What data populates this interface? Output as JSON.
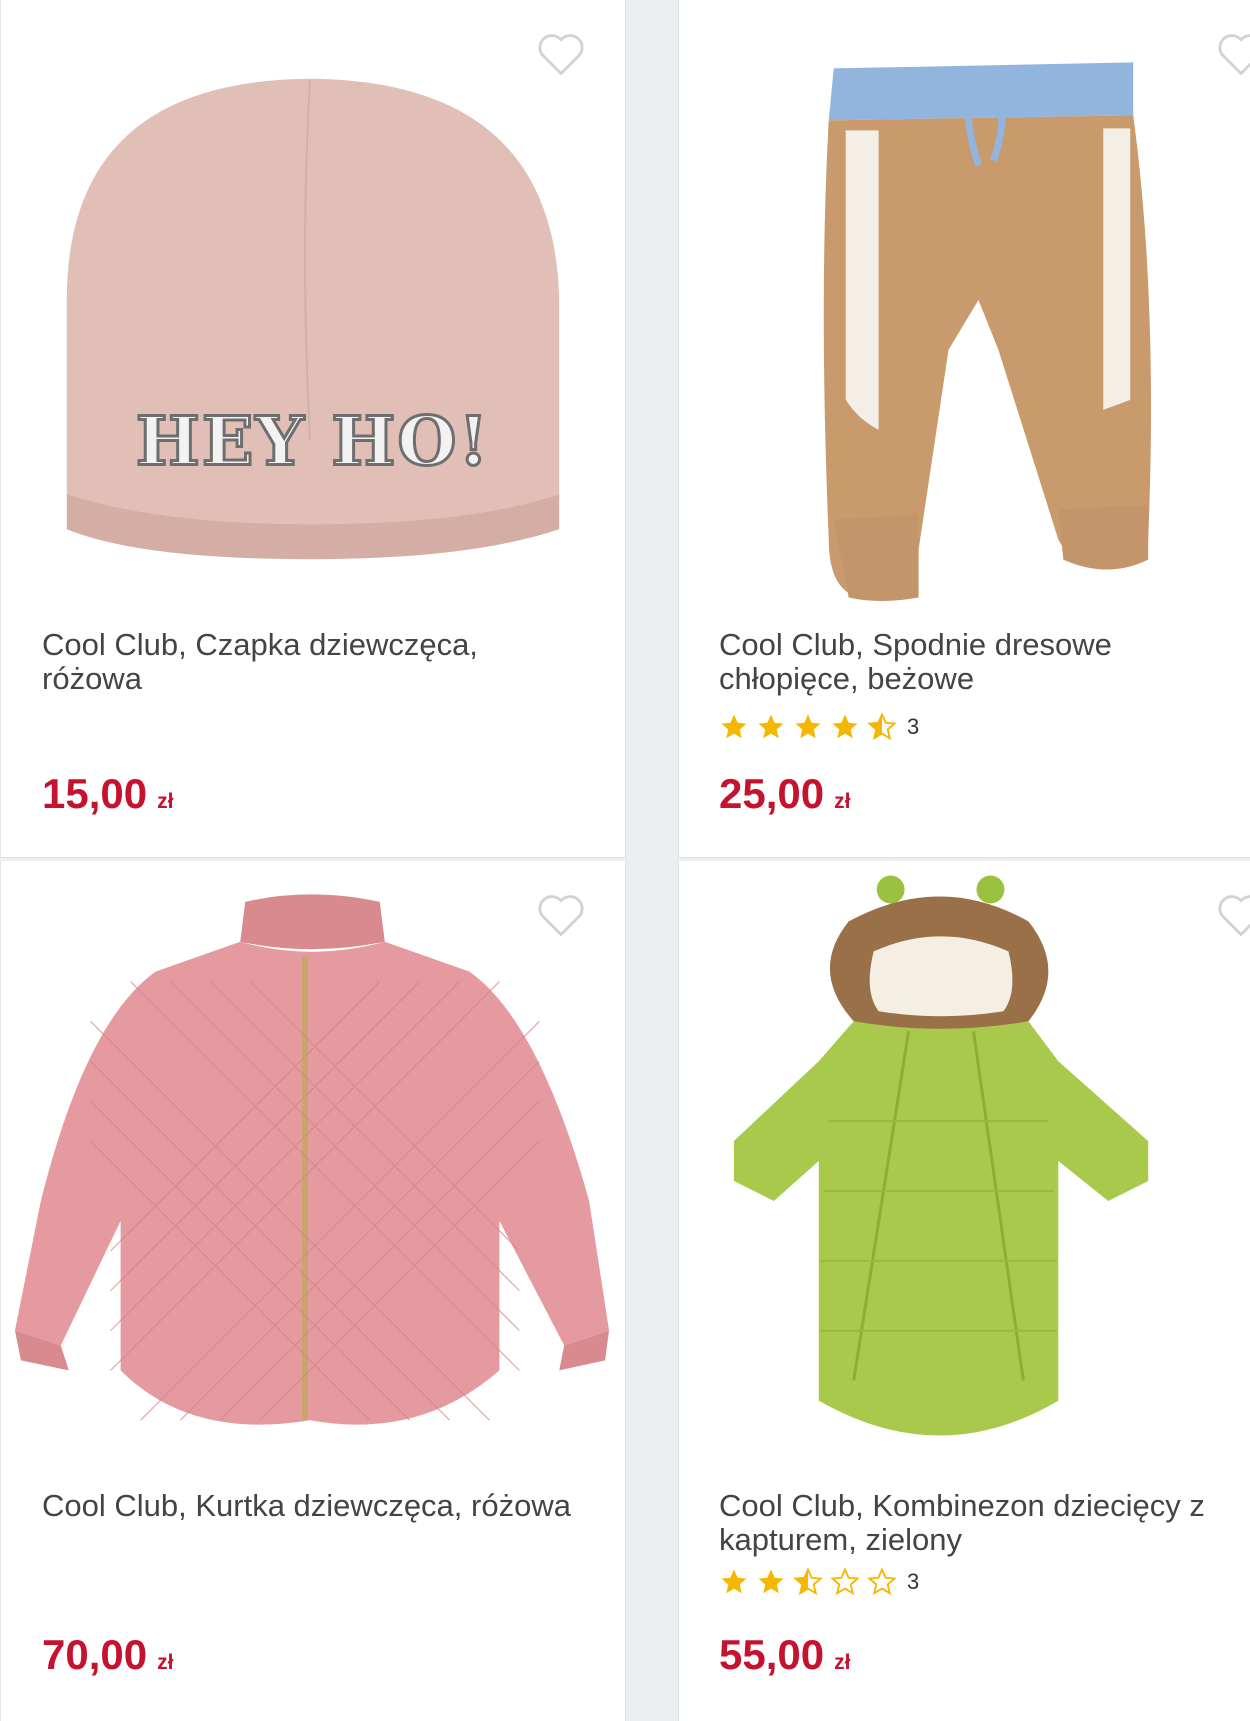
{
  "products": [
    {
      "title": "Cool Club, Czapka dziewczęca, różowa",
      "price": "15,00",
      "currency": "zł",
      "rating": null,
      "rating_count": null,
      "image": "pink-beanie-hey-ho",
      "image_text": "HEY HO!"
    },
    {
      "title": "Cool Club, Spodnie dresowe chłopięce, beżowe",
      "price": "25,00",
      "currency": "zł",
      "rating": 4.5,
      "rating_count": "3",
      "image": "beige-fleece-joggers"
    },
    {
      "title": "Cool Club, Kurtka dziewczęca, różowa",
      "price": "70,00",
      "currency": "zł",
      "rating": null,
      "rating_count": null,
      "image": "pink-quilted-jacket"
    },
    {
      "title": "Cool Club, Kombinezon dziecięcy z kapturem, zielony",
      "price": "55,00",
      "currency": "zł",
      "rating": 2.5,
      "rating_count": "3",
      "image": "green-baby-snowsuit"
    }
  ],
  "colors": {
    "price": "#c4122f",
    "star": "#f5b800",
    "heart": "#cfd3d6"
  },
  "icons": {
    "favorite": "heart-outline-icon",
    "rating": "star-icon"
  }
}
